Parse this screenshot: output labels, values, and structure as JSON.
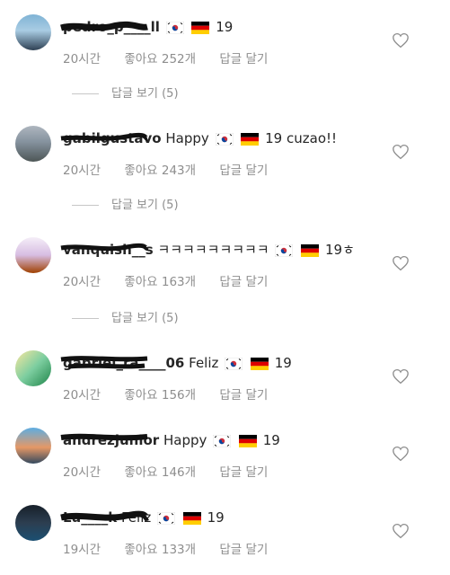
{
  "comments": [
    {
      "username": "pedro_p____ll",
      "text": "",
      "time": "20시간",
      "likes": "좋아요 252개",
      "reply": "답글 달기",
      "number": "19",
      "flags": [
        "korea-flag-icon",
        "germany-flag-icon"
      ],
      "view_replies": "답글 보기 (5)"
    },
    {
      "username": "gabilgustavo",
      "text": "Happy",
      "time": "20시간",
      "likes": "좋아요 243개",
      "reply": "답글 달기",
      "number": "19 cuzao!!",
      "flags": [
        "korea-flag-icon",
        "germany-flag-icon"
      ],
      "view_replies": "답글 보기 (5)"
    },
    {
      "username": "vanquish__s",
      "text": "ㅋㅋㅋㅋㅋㅋㅋㅋㅋ",
      "time": "20시간",
      "likes": "좋아요 163개",
      "reply": "답글 달기",
      "number": "19ㅎ",
      "flags": [
        "korea-flag-icon",
        "germany-flag-icon"
      ],
      "view_replies": "답글 보기 (5)"
    },
    {
      "username": "gabriel_ra____06",
      "text": "Feliz",
      "time": "20시간",
      "likes": "좋아요 156개",
      "reply": "답글 달기",
      "number": "19",
      "flags": [
        "korea-flag-icon",
        "germany-flag-icon"
      ]
    },
    {
      "username": "andrezjunior",
      "text": "Happy",
      "time": "20시간",
      "likes": "좋아요 146개",
      "reply": "답글 달기",
      "number": "19",
      "flags": [
        "korea-flag-icon",
        "germany-flag-icon"
      ]
    },
    {
      "username": "Lu____k",
      "text": "Feliz",
      "time": "19시간",
      "likes": "좋아요 133개",
      "reply": "답글 달기",
      "number": "19",
      "flags": [
        "korea-flag-icon",
        "germany-flag-icon"
      ]
    }
  ],
  "colors": {
    "meta": "#8e8e8e",
    "text": "#262626",
    "redaction": "#111111"
  }
}
